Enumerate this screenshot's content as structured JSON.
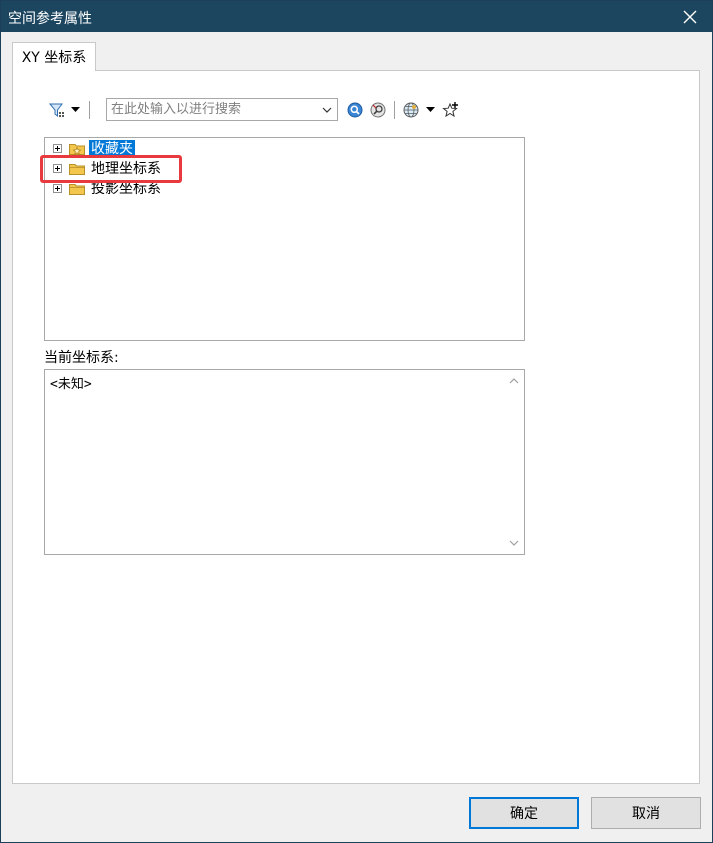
{
  "window": {
    "title": "空间参考属性"
  },
  "tabs": [
    {
      "label": "XY 坐标系"
    }
  ],
  "toolbar": {
    "search_placeholder": "在此处输入以进行搜索",
    "icons": [
      "filter-icon",
      "dropdown-arrow-icon",
      "search-icon",
      "clear-search-icon",
      "globe-icon",
      "add-coordinate-system-icon"
    ]
  },
  "tree": {
    "items": [
      {
        "label": "收藏夹",
        "icon": "favorites-folder-icon",
        "selected": true
      },
      {
        "label": "地理坐标系",
        "icon": "folder-icon",
        "selected": false,
        "highlighted": true
      },
      {
        "label": "投影坐标系",
        "icon": "folder-icon",
        "selected": false
      }
    ]
  },
  "current": {
    "label": "当前坐标系:",
    "value": "<未知>"
  },
  "buttons": {
    "ok": "确定",
    "cancel": "取消"
  },
  "colors": {
    "titlebar": "#1c4660",
    "selection": "#0078d7",
    "highlight": "#e8393f",
    "folder": "#f3c64e"
  }
}
